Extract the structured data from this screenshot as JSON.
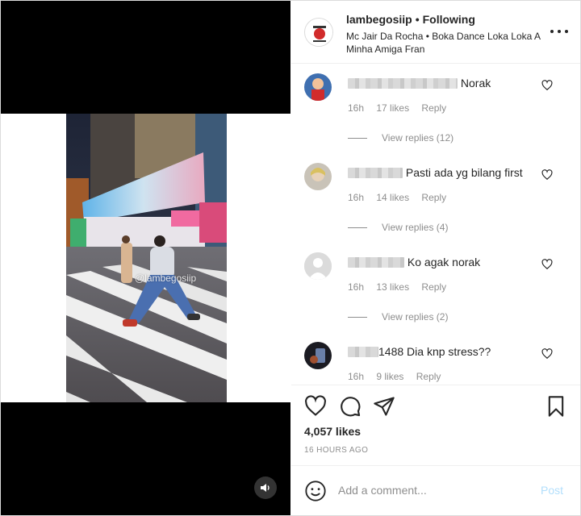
{
  "header": {
    "username": "lambegosiip",
    "separator": "•",
    "follow_status": "Following",
    "music": "Mc Jair Da Rocha • Boka Dance Loka Loka A Minha Amiga Fran"
  },
  "video": {
    "watermark": "@lambegosiip",
    "mute_icon": "speaker-icon"
  },
  "comments": [
    {
      "text": "Norak",
      "time": "16h",
      "likes": "17 likes",
      "reply_label": "Reply",
      "view_replies": "View replies (12)"
    },
    {
      "text": "Pasti ada yg bilang first",
      "time": "16h",
      "likes": "14 likes",
      "reply_label": "Reply",
      "view_replies": "View replies (4)"
    },
    {
      "text": "Ko agak norak",
      "time": "16h",
      "likes": "13 likes",
      "reply_label": "Reply",
      "view_replies": "View replies (2)"
    },
    {
      "username_visible": "1488",
      "text": "Dia knp stress??",
      "time": "16h",
      "likes": "9 likes",
      "reply_label": "Reply"
    }
  ],
  "actions": {
    "likes": "4,057 likes",
    "timestamp": "16 HOURS AGO"
  },
  "add_comment": {
    "placeholder": "Add a comment...",
    "post_label": "Post"
  },
  "colors": {
    "post_disabled": "#b2dffc",
    "secondary_text": "#8e8e8e",
    "primary_text": "#262626"
  }
}
